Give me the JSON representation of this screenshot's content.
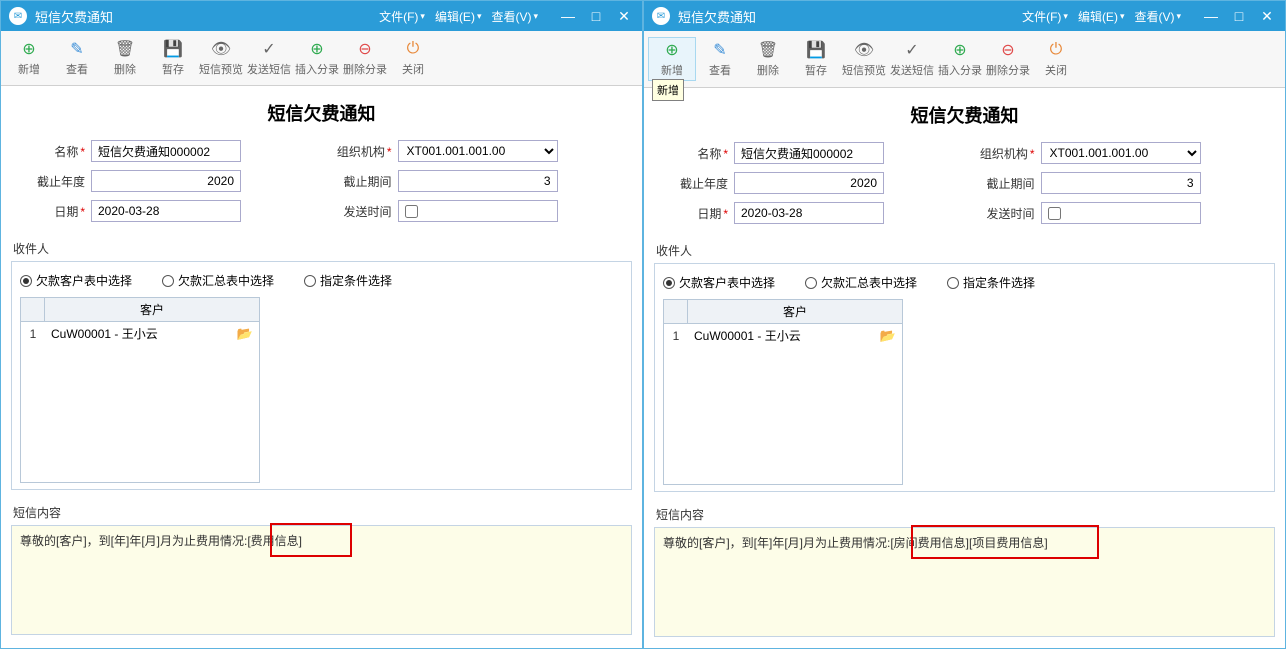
{
  "left": {
    "titlebar": {
      "title": "短信欠费通知"
    },
    "menus": {
      "file": "文件(F)",
      "edit": "编辑(E)",
      "view": "查看(V)"
    },
    "toolbar": {
      "add": "新增",
      "view": "查看",
      "delete": "删除",
      "draft": "暂存",
      "preview": "短信预览",
      "send": "发送短信",
      "insertcat": "插入分录",
      "deletecat": "删除分录",
      "close": "关闭"
    },
    "page_title": "短信欠费通知",
    "form": {
      "name_label": "名称",
      "name_value": "短信欠费通知000002",
      "org_label": "组织机构",
      "org_value": "XT001.001.001.00",
      "year_label": "截止年度",
      "year_value": "2020",
      "period_label": "截止期间",
      "period_value": "3",
      "date_label": "日期",
      "date_value": "2020-03-28",
      "sendtime_label": "发送时间"
    },
    "recipients": {
      "label": "收件人",
      "opt1": "欠款客户表中选择",
      "opt2": "欠款汇总表中选择",
      "opt3": "指定条件选择",
      "col_header": "客户",
      "row1_num": "1",
      "row1_value": "CuW00001 - 王小云"
    },
    "sms": {
      "label": "短信内容",
      "text": "尊敬的[客户]，到[年]年[月]月为止费用情况:[费用信息]"
    }
  },
  "right": {
    "titlebar": {
      "title": "短信欠费通知"
    },
    "menus": {
      "file": "文件(F)",
      "edit": "编辑(E)",
      "view": "查看(V)"
    },
    "toolbar": {
      "add": "新增",
      "view": "查看",
      "delete": "删除",
      "draft": "暂存",
      "preview": "短信预览",
      "send": "发送短信",
      "insertcat": "插入分录",
      "deletecat": "删除分录",
      "close": "关闭"
    },
    "tooltip_add": "新增",
    "page_title": "短信欠费通知",
    "form": {
      "name_label": "名称",
      "name_value": "短信欠费通知000002",
      "org_label": "组织机构",
      "org_value": "XT001.001.001.00",
      "year_label": "截止年度",
      "year_value": "2020",
      "period_label": "截止期间",
      "period_value": "3",
      "date_label": "日期",
      "date_value": "2020-03-28",
      "sendtime_label": "发送时间"
    },
    "recipients": {
      "label": "收件人",
      "opt1": "欠款客户表中选择",
      "opt2": "欠款汇总表中选择",
      "opt3": "指定条件选择",
      "col_header": "客户",
      "row1_num": "1",
      "row1_value": "CuW00001 - 王小云"
    },
    "sms": {
      "label": "短信内容",
      "text": "尊敬的[客户]，到[年]年[月]月为止费用情况:[房间费用信息][项目费用信息]"
    }
  }
}
